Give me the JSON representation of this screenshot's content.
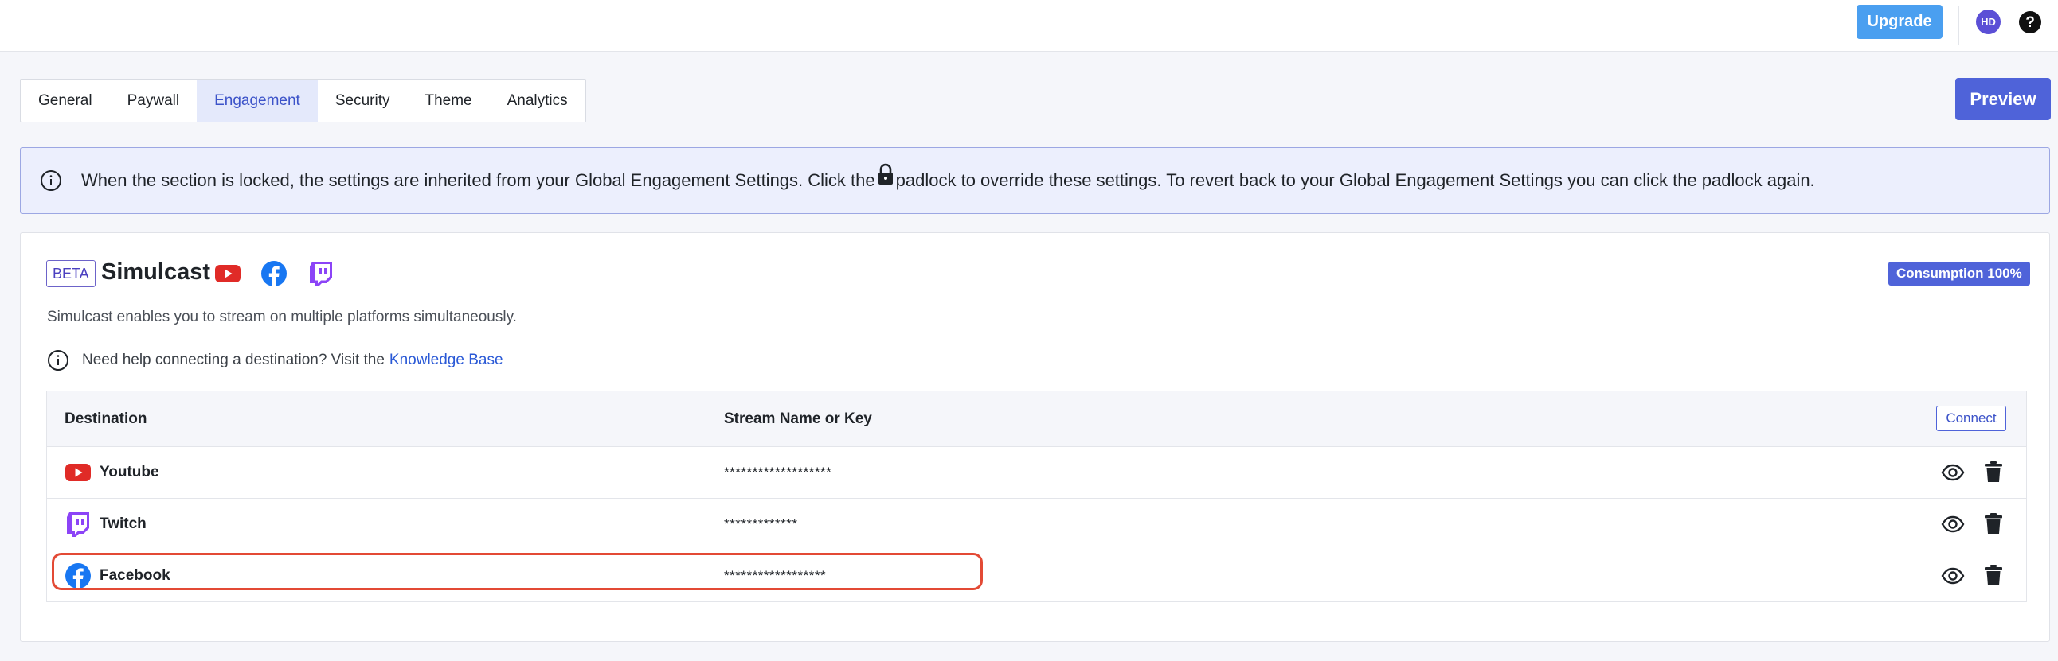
{
  "topbar": {
    "upgrade_label": "Upgrade",
    "avatar_initials": "HD",
    "help_icon": "question-circle-icon"
  },
  "tabs": [
    {
      "label": "General",
      "active": false
    },
    {
      "label": "Paywall",
      "active": false
    },
    {
      "label": "Engagement",
      "active": true
    },
    {
      "label": "Security",
      "active": false
    },
    {
      "label": "Theme",
      "active": false
    },
    {
      "label": "Analytics",
      "active": false
    }
  ],
  "preview_label": "Preview",
  "banner": {
    "text_before": "When the section is locked, the settings are inherited from your Global Engagement Settings. Click the",
    "text_after": "padlock to override these settings. To revert back to your Global Engagement Settings you can click the padlock again.",
    "icon": "info-circle-icon",
    "lock_icon": "padlock-icon"
  },
  "simulcast": {
    "beta_label": "BETA",
    "title": "Simulcast",
    "consumption_label": "Consumption 100%",
    "description": "Simulcast enables you to stream on multiple platforms simultaneously.",
    "help_text": "Need help connecting a destination? Visit the",
    "help_link": "Knowledge Base"
  },
  "table": {
    "headers": {
      "destination": "Destination",
      "stream_key": "Stream Name or Key"
    },
    "connect_label": "Connect",
    "rows": [
      {
        "platform": "Youtube",
        "icon": "youtube-icon",
        "key": "*******************"
      },
      {
        "platform": "Twitch",
        "icon": "twitch-icon",
        "key": "*************"
      },
      {
        "platform": "Facebook",
        "icon": "facebook-icon",
        "key": "******************",
        "highlighted": true
      }
    ]
  },
  "colors": {
    "accent": "#4f63d9",
    "upgrade": "#4a9ff0",
    "youtube": "#e02b27",
    "facebook": "#1877f2",
    "twitch": "#8c44f7",
    "highlight": "#e34a35"
  }
}
